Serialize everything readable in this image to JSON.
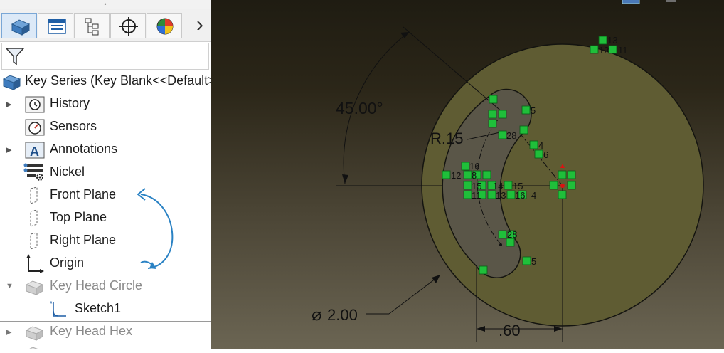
{
  "feature_manager": {
    "top_handle": "•",
    "tabs": [
      {
        "name": "feature-tree-tab"
      },
      {
        "name": "property-manager-tab"
      },
      {
        "name": "configuration-manager-tab"
      },
      {
        "name": "dimxpert-tab"
      },
      {
        "name": "display-manager-tab"
      }
    ],
    "more_arrow": "›",
    "part_title": "Key Series  (Key Blank<<Default>",
    "items": [
      {
        "label": "History"
      },
      {
        "label": "Sensors"
      },
      {
        "label": "Annotations"
      },
      {
        "label": "Nickel"
      },
      {
        "label": "Front Plane"
      },
      {
        "label": "Top Plane"
      },
      {
        "label": "Right Plane"
      },
      {
        "label": "Origin"
      },
      {
        "label": "Key Head Circle"
      },
      {
        "label": "Sketch1"
      },
      {
        "label": "Key Head Hex"
      }
    ]
  },
  "sketch": {
    "angle_dim": "45.00°",
    "radius_dim": "R.15",
    "diameter_dim": "2.00",
    "diameter_symbol": "⌀",
    "offset_dim": ".60",
    "relation_labels": {
      "r13": "13",
      "r12a": "12",
      "r11a": "11",
      "r5a": "5",
      "r28a": "28",
      "r4a": "4",
      "r6": "6",
      "r16a": "16",
      "r12b": "12",
      "r8": "8",
      "r15a": "15",
      "r14": "14",
      "r15b": "15",
      "r11b": "11",
      "r13b": "13",
      "r16b": "16",
      "r4b": "4",
      "r28b": "28",
      "r5b": "5"
    }
  }
}
